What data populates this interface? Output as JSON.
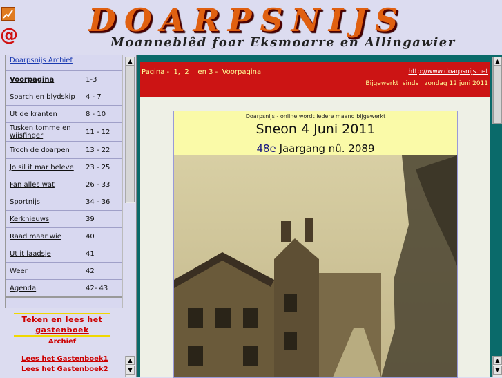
{
  "header": {
    "title": "DOARPSNIJS",
    "subtitle": "Moanneblêd foar Eksmoarre en Allingawier",
    "icons": [
      "chart-icon",
      "at-icon"
    ]
  },
  "sidebar": {
    "archive_link": "Doarpsnijs Archief",
    "items": [
      {
        "label": "Voorpagina",
        "pages": "1-3"
      },
      {
        "label": "Soarch en blydskip",
        "pages": "4 - 7"
      },
      {
        "label": "Ut de kranten",
        "pages": "8 - 10"
      },
      {
        "label": "Tusken tomme en wiisfinger",
        "pages": "11 - 12"
      },
      {
        "label": "Troch de doarpen",
        "pages": "13 - 22"
      },
      {
        "label": "Jo sil it mar beleve",
        "pages": "23 - 25"
      },
      {
        "label": "Fan alles wat",
        "pages": "26 - 33"
      },
      {
        "label": "Sportnijs",
        "pages": "34 - 36"
      },
      {
        "label": "Kerknieuws",
        "pages": "39"
      },
      {
        "label": "Raad maar wie",
        "pages": "40"
      },
      {
        "label": "Ut it laadsje",
        "pages": "41"
      },
      {
        "label": "Weer",
        "pages": "42"
      },
      {
        "label": "Agenda",
        "pages": "42- 43"
      }
    ],
    "guestbook": {
      "link": "Teken en lees het gastenboek",
      "archive": "Archief",
      "book1": "Lees  het Gastenboek1",
      "book2": "Lees  het Gastenboek2"
    }
  },
  "content": {
    "page_nav": "Pagina -  1,  2    en 3 -  Voorpagina",
    "url": "http://www.doarpsnijs.net",
    "updated": "Bijgewerkt  sinds   zondag 12 juni 2011",
    "online_note": "Doarpsnijs - online wordt  iedere  maand bijgewerkt",
    "date": "Sneon  4 Juni  2011",
    "jaargang_ordinal": "48e",
    "jaargang_rest": " Jaargang   nû.  2089"
  },
  "colors": {
    "background": "#dcdcf0",
    "logo": "#e06010",
    "frame": "#0a6a6a",
    "redbar": "#cc1414",
    "panel": "#fafaa8",
    "link_red": "#cc0000"
  }
}
